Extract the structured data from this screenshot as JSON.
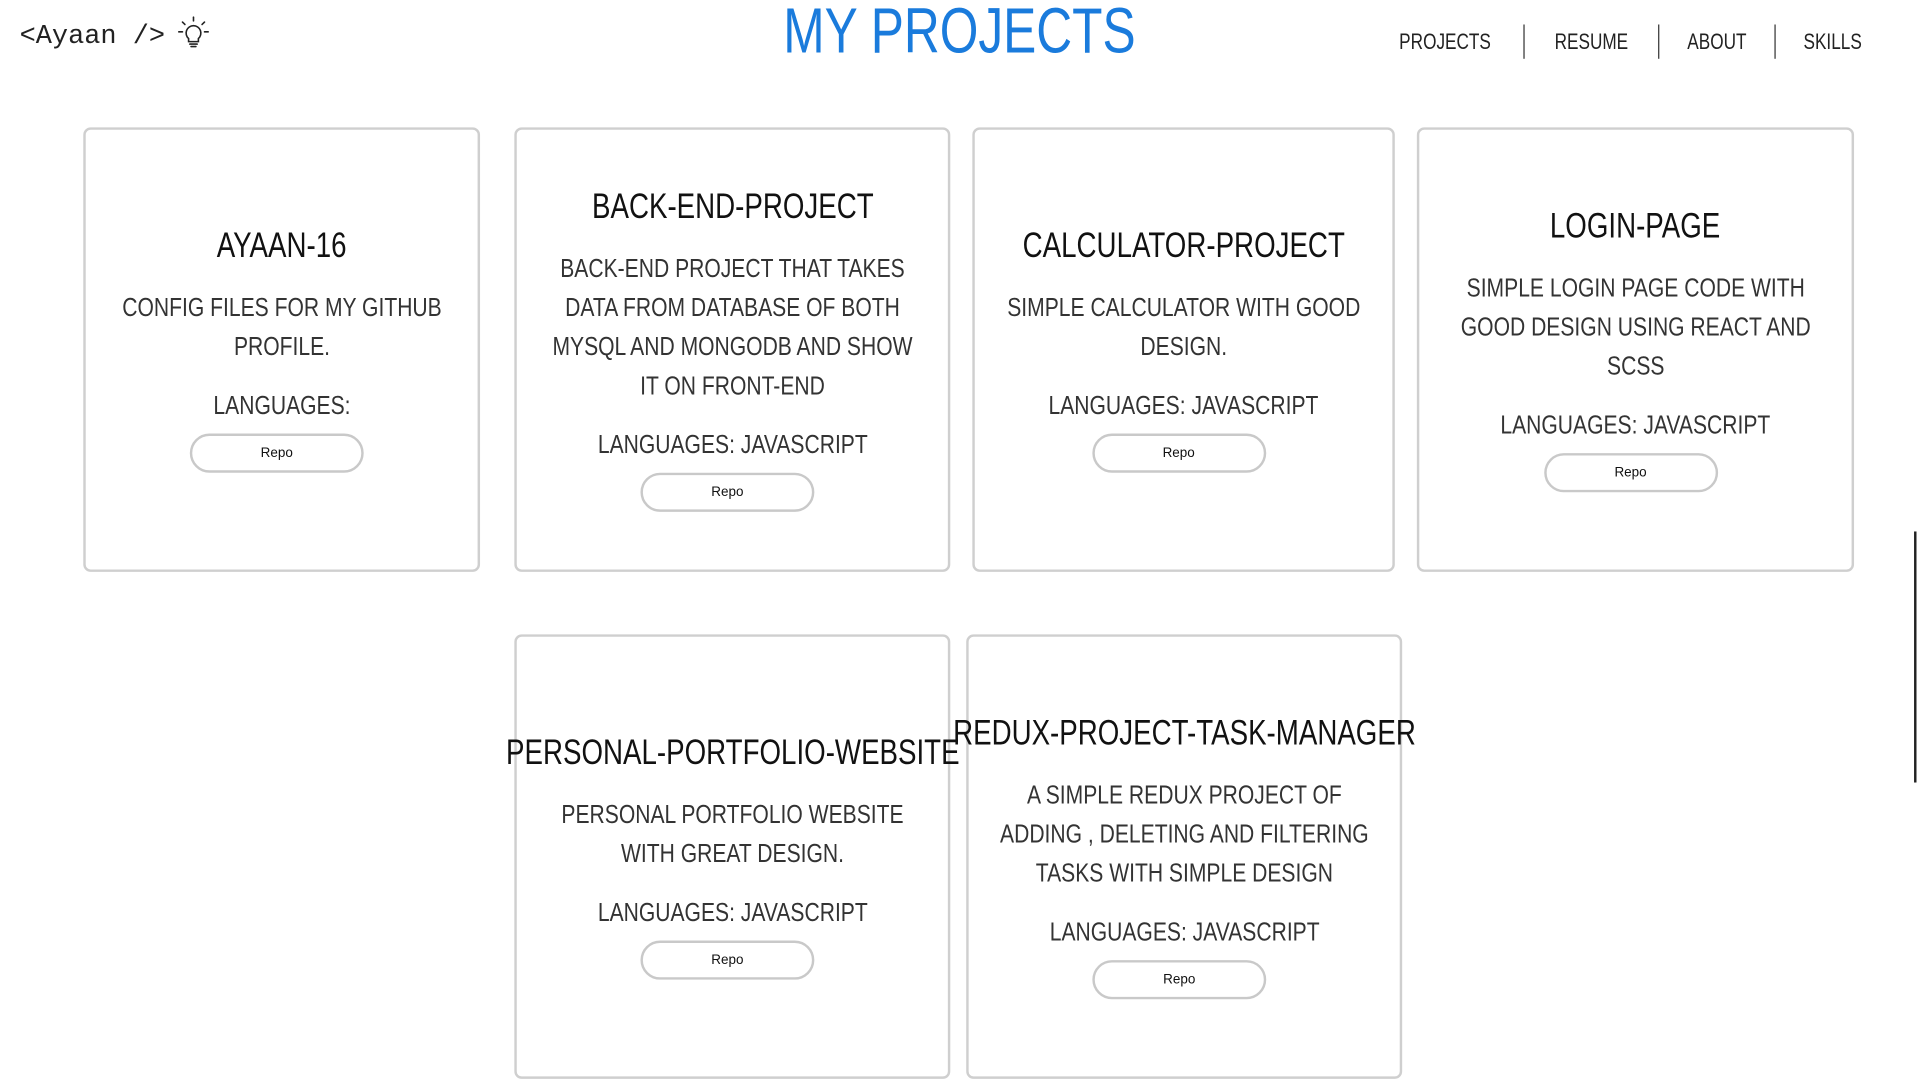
{
  "header": {
    "logo_text": "<Ayaan />",
    "page_title": "MY PROJECTS",
    "nav": [
      "PROJECTS",
      "RESUME",
      "ABOUT",
      "SKILLS"
    ]
  },
  "projects": [
    {
      "title": "AYAAN-16",
      "description": "CONFIG FILES FOR MY GITHUB PROFILE.",
      "languages": "LANGUAGES:",
      "button": "Repo"
    },
    {
      "title": "BACK-END-PROJECT",
      "description": "BACK-END PROJECT THAT TAKES DATA FROM DATABASE OF BOTH MYSQL AND MONGODB AND SHOW IT ON FRONT-END",
      "languages": "LANGUAGES: JAVASCRIPT",
      "button": "Repo"
    },
    {
      "title": "CALCULATOR-PROJECT",
      "description": "SIMPLE CALCULATOR WITH GOOD DESIGN.",
      "languages": "LANGUAGES: JAVASCRIPT",
      "button": "Repo"
    },
    {
      "title": "LOGIN-PAGE",
      "description": "SIMPLE LOGIN PAGE CODE WITH GOOD DESIGN USING REACT AND SCSS",
      "languages": "LANGUAGES: JAVASCRIPT",
      "button": "Repo"
    },
    {
      "title": "PERSONAL-PORTFOLIO-WEBSITE",
      "description": "PERSONAL PORTFOLIO WEBSITE WITH GREAT DESIGN.",
      "languages": "LANGUAGES: JAVASCRIPT",
      "button": "Repo"
    },
    {
      "title": "REDUX-PROJECT-TASK-MANAGER",
      "description": "A SIMPLE REDUX PROJECT OF ADDING , DELETING AND FILTERING TASKS WITH SIMPLE DESIGN",
      "languages": "LANGUAGES: JAVASCRIPT",
      "button": "Repo"
    }
  ]
}
